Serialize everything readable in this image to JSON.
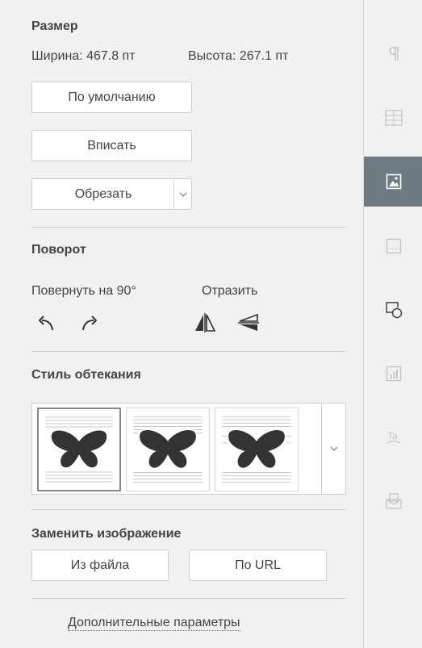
{
  "size": {
    "title": "Размер",
    "width_label": "Ширина: 467.8 пт",
    "height_label": "Высота: 267.1 пт",
    "default_button": "По умолчанию",
    "fit_button": "Вписать",
    "crop_button": "Обрезать"
  },
  "rotation": {
    "title": "Поворот",
    "rotate_label": "Повернуть на 90°",
    "flip_label": "Отразить"
  },
  "wrapping": {
    "title": "Стиль обтекания"
  },
  "replace": {
    "title": "Заменить изображение",
    "from_file_button": "Из файла",
    "from_url_button": "По URL"
  },
  "advanced_link": "Дополнительные параметры",
  "rightbar": {
    "items": [
      {
        "icon": "paragraph-icon"
      },
      {
        "icon": "table-icon"
      },
      {
        "icon": "image-icon",
        "active": true
      },
      {
        "icon": "header-footer-icon"
      },
      {
        "icon": "shape-icon"
      },
      {
        "icon": "chart-icon"
      },
      {
        "icon": "text-art-icon"
      },
      {
        "icon": "mail-merge-icon"
      }
    ],
    "active_color": "#6e7b83"
  }
}
